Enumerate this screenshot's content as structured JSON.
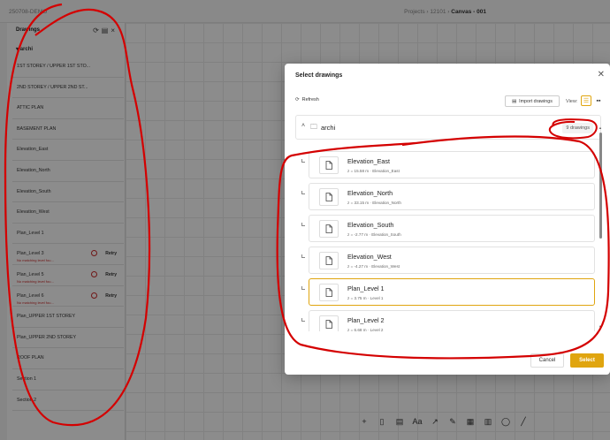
{
  "app": {
    "project_name": "250708-DEMO",
    "breadcrumbs": [
      "Projects",
      "12101",
      "Canvas - 001"
    ]
  },
  "sidebar": {
    "title": "Drawings",
    "folder": "archi",
    "items": [
      {
        "label": "1ST STOREY / UPPER 1ST STO...",
        "error": "",
        "retry": ""
      },
      {
        "label": "2ND STOREY / UPPER 2ND ST...",
        "error": "",
        "retry": ""
      },
      {
        "label": "ATTIC PLAN",
        "error": "",
        "retry": ""
      },
      {
        "label": "BASEMENT PLAN",
        "error": "",
        "retry": ""
      },
      {
        "label": "Elevation_East",
        "error": "",
        "retry": ""
      },
      {
        "label": "Elevation_North",
        "error": "",
        "retry": ""
      },
      {
        "label": "Elevation_South",
        "error": "",
        "retry": ""
      },
      {
        "label": "Elevation_West",
        "error": "",
        "retry": ""
      },
      {
        "label": "Plan_Level 1",
        "error": "",
        "retry": ""
      },
      {
        "label": "Plan_Level 3",
        "error": "No matching level fou...",
        "retry": "Retry"
      },
      {
        "label": "Plan_Level 5",
        "error": "No matching level fou...",
        "retry": "Retry"
      },
      {
        "label": "Plan_Level 6",
        "error": "No matching level fou...",
        "retry": "Retry"
      },
      {
        "label": "Plan_UPPER 1ST STOREY",
        "error": "",
        "retry": ""
      },
      {
        "label": "Plan_UPPER 2ND STOREY",
        "error": "",
        "retry": ""
      },
      {
        "label": "ROOF PLAN",
        "error": "",
        "retry": ""
      },
      {
        "label": "Section 1",
        "error": "",
        "retry": ""
      },
      {
        "label": "Section 2",
        "error": "",
        "retry": ""
      }
    ]
  },
  "modal": {
    "title": "Select drawings",
    "close": "✕",
    "refresh_label": "Refresh",
    "import_label": "Import drawings",
    "view_label": "View:",
    "folder_name": "archi",
    "drawing_count": "9 drawings",
    "drawings": [
      {
        "name": "Elevation_East",
        "sub": "z = 15.58 m · Elevation_East",
        "selected": false
      },
      {
        "name": "Elevation_North",
        "sub": "z = 33.15 m · Elevation_North",
        "selected": false
      },
      {
        "name": "Elevation_South",
        "sub": "z = -2.77 m · Elevation_South",
        "selected": false
      },
      {
        "name": "Elevation_West",
        "sub": "z = -4.27 m · Elevation_West",
        "selected": false
      },
      {
        "name": "Plan_Level 1",
        "sub": "z = 3.75 m · Level 1",
        "selected": true
      },
      {
        "name": "Plan_Level 2",
        "sub": "z = 6.68 m · Level 2",
        "selected": false
      }
    ],
    "cancel_label": "Cancel",
    "select_label": "Select"
  },
  "colors": {
    "accent": "#e0a50f",
    "error": "#cc2b2b",
    "annotation": "#d40000"
  }
}
